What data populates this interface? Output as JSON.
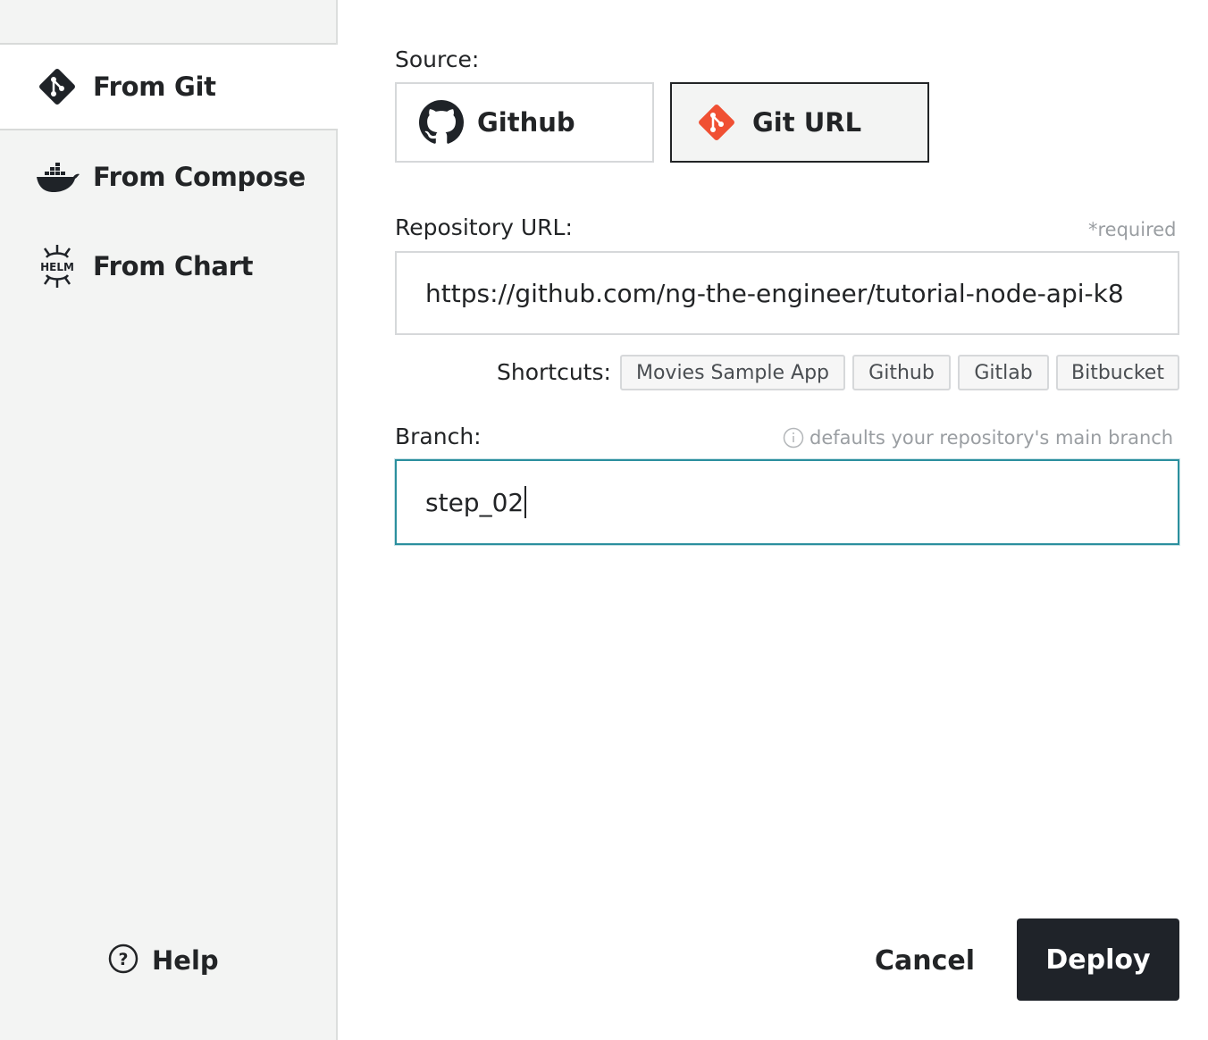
{
  "sidebar": {
    "items": [
      {
        "label": "From Git",
        "icon": "git-icon",
        "active": true
      },
      {
        "label": "From Compose",
        "icon": "docker-icon",
        "active": false
      },
      {
        "label": "From Chart",
        "icon": "helm-icon",
        "active": false
      }
    ],
    "help_label": "Help"
  },
  "source": {
    "label": "Source:",
    "options": [
      {
        "label": "Github",
        "icon": "github-icon",
        "selected": false
      },
      {
        "label": "Git URL",
        "icon": "git-icon",
        "selected": true
      }
    ]
  },
  "repository": {
    "label": "Repository URL:",
    "required_hint": "*required",
    "value": "https://github.com/ng-the-engineer/tutorial-node-api-k8"
  },
  "shortcuts": {
    "label": "Shortcuts:",
    "items": [
      "Movies Sample App",
      "Github",
      "Gitlab",
      "Bitbucket"
    ]
  },
  "branch": {
    "label": "Branch:",
    "hint": "defaults your repository's main branch",
    "value": "step_02"
  },
  "actions": {
    "cancel_label": "Cancel",
    "deploy_label": "Deploy"
  },
  "colors": {
    "git_orange": "#f05033",
    "focus_teal": "#2b8f9e",
    "deploy_bg": "#1f2329"
  }
}
